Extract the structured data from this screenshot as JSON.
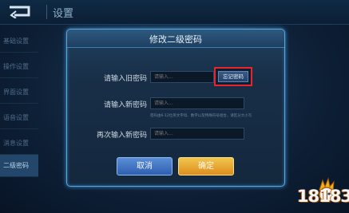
{
  "header": {
    "title": "设置"
  },
  "sidebar": {
    "items": [
      {
        "label": "基础设置"
      },
      {
        "label": "操作设置"
      },
      {
        "label": "界面设置"
      },
      {
        "label": "语音设置"
      },
      {
        "label": "消息设置"
      },
      {
        "label": "二级密码"
      }
    ]
  },
  "dialog": {
    "title": "修改二级密码",
    "old_password": {
      "label": "请输入旧密码",
      "placeholder": "请输入..."
    },
    "forgot_label": "忘记密码",
    "new_password": {
      "label": "请输入新密码",
      "placeholder": "请输入...",
      "hint": "密码由6-12位英文字母、数字以及特殊符号组合，请区分大小写"
    },
    "confirm_password": {
      "label": "再次输入新密码",
      "placeholder": "请输入..."
    },
    "cancel_label": "取消",
    "confirm_label": "确定"
  },
  "watermark": {
    "text": "18183"
  },
  "colors": {
    "accent": "#5aa7dc",
    "highlight_box": "#e8262a",
    "cancel": "#3e72c4",
    "confirm": "#e9a93a"
  }
}
